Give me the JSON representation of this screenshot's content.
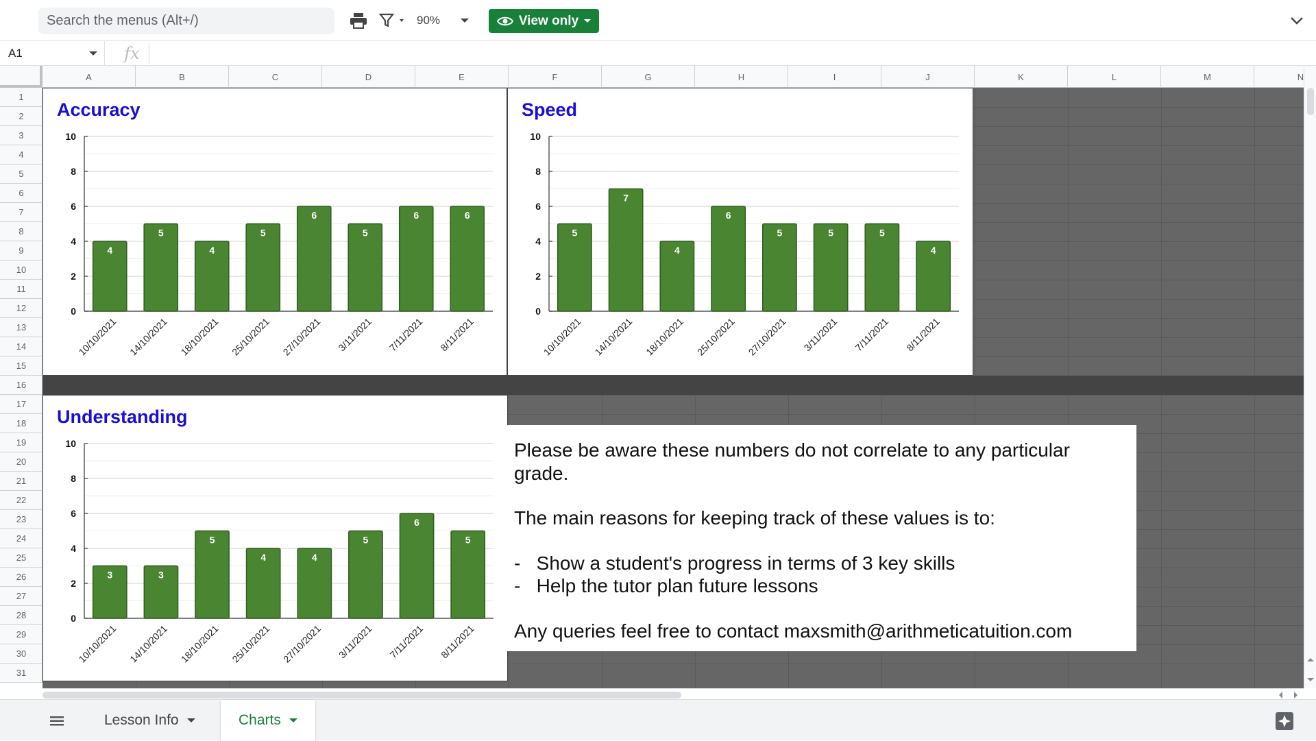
{
  "toolbar": {
    "search_placeholder": "Search the menus (Alt+/)",
    "zoom": "90%",
    "view_only_label": "View only"
  },
  "formula_bar": {
    "cell_ref": "A1",
    "fx_label": "fx"
  },
  "columns": [
    "A",
    "B",
    "C",
    "D",
    "E",
    "F",
    "G",
    "H",
    "I",
    "J",
    "K",
    "L",
    "M",
    "N"
  ],
  "rows": [
    "1",
    "2",
    "3",
    "4",
    "5",
    "6",
    "7",
    "8",
    "9",
    "10",
    "11",
    "12",
    "13",
    "14",
    "15",
    "16",
    "17",
    "18",
    "19",
    "20",
    "21",
    "22",
    "23",
    "24",
    "25",
    "26",
    "27",
    "28",
    "29",
    "30",
    "31"
  ],
  "chart_data": [
    {
      "type": "bar",
      "title": "Accuracy",
      "categories": [
        "10/10/2021",
        "14/10/2021",
        "18/10/2021",
        "25/10/2021",
        "27/10/2021",
        "3/11/2021",
        "7/11/2021",
        "8/11/2021"
      ],
      "values": [
        4,
        5,
        4,
        5,
        6,
        5,
        6,
        6
      ],
      "ylim": [
        0,
        10
      ],
      "yticks": [
        0,
        2,
        4,
        6,
        8,
        10
      ],
      "bar_color": "#4a8532",
      "grid": true,
      "data_labels": true
    },
    {
      "type": "bar",
      "title": "Speed",
      "categories": [
        "10/10/2021",
        "14/10/2021",
        "18/10/2021",
        "25/10/2021",
        "27/10/2021",
        "3/11/2021",
        "7/11/2021",
        "8/11/2021"
      ],
      "values": [
        5,
        7,
        4,
        6,
        5,
        5,
        5,
        4
      ],
      "ylim": [
        0,
        10
      ],
      "yticks": [
        0,
        2,
        4,
        6,
        8,
        10
      ],
      "bar_color": "#4a8532",
      "grid": true,
      "data_labels": true
    },
    {
      "type": "bar",
      "title": "Understanding",
      "categories": [
        "10/10/2021",
        "14/10/2021",
        "18/10/2021",
        "25/10/2021",
        "27/10/2021",
        "3/11/2021",
        "7/11/2021",
        "8/11/2021"
      ],
      "values": [
        3,
        3,
        5,
        4,
        4,
        5,
        6,
        5
      ],
      "ylim": [
        0,
        10
      ],
      "yticks": [
        0,
        2,
        4,
        6,
        8,
        10
      ],
      "bar_color": "#4a8532",
      "grid": true,
      "data_labels": true
    }
  ],
  "note": {
    "line1": "Please be aware these numbers do not correlate to any particular grade.",
    "line2": "The main reasons for keeping track of these values is to:",
    "bullet1": "Show a student's progress in terms of 3 key skills",
    "bullet2": "Help the tutor plan future lessons",
    "bullet_mark": "-",
    "line3": "Any queries feel free to contact maxsmith@arithmeticatuition.com"
  },
  "sheet_tabs": [
    {
      "label": "Lesson Info",
      "active": false
    },
    {
      "label": "Charts",
      "active": true
    }
  ],
  "colors": {
    "accent_green": "#188038",
    "chart_title": "#1a0dd6",
    "bar": "#4a8532"
  }
}
